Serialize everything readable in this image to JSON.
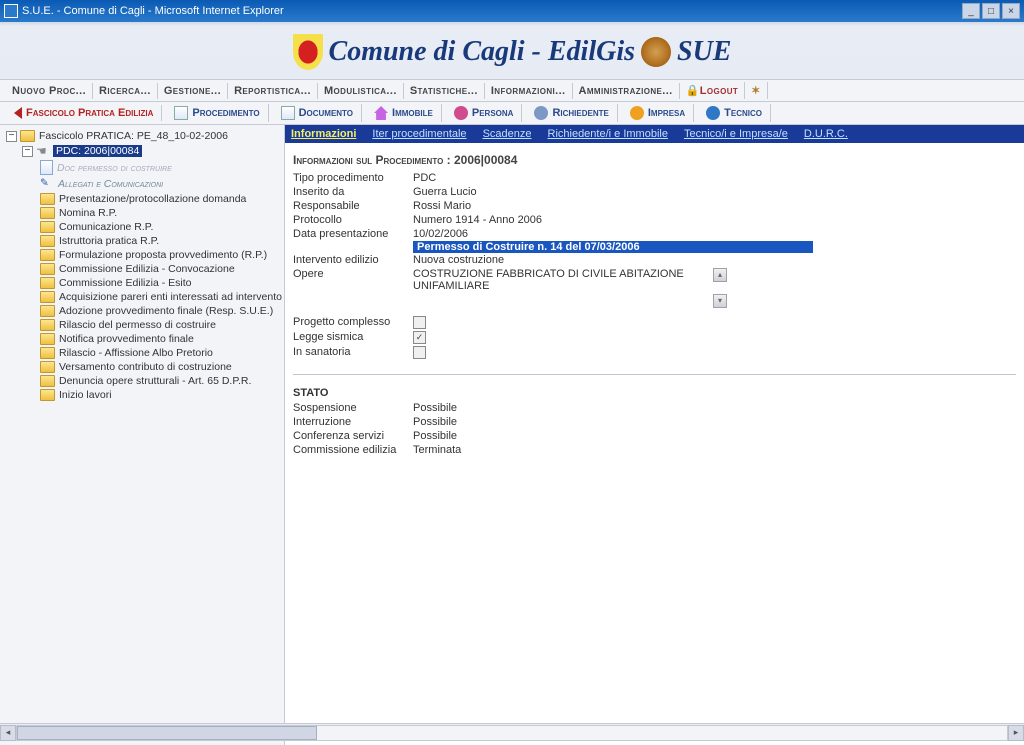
{
  "window": {
    "title": "S.U.E. - Comune di Cagli - Microsoft Internet Explorer"
  },
  "header": {
    "title_a": "Comune di Cagli - EdilGis",
    "title_b": "SUE"
  },
  "toolbar": {
    "items": [
      "Nuovo Proc...",
      "Ricerca...",
      "Gestione...",
      "Reportistica...",
      "Modulistica...",
      "Statistiche...",
      "Informazioni...",
      "Amministrazione..."
    ],
    "logout": "Logout"
  },
  "subtoolbar": {
    "fascicolo": "Fascicolo Pratica Edilizia",
    "procedimento": "Procedimento",
    "documento": "Documento",
    "immobile": "Immobile",
    "persona": "Persona",
    "richiedente": "Richiedente",
    "impresa": "Impresa",
    "tecnico": "Tecnico"
  },
  "tree": {
    "root": "Fascicolo PRATICA: PE_48_10-02-2006",
    "selected": "PDC: 2006|00084",
    "doc": "Doc permesso di costruire",
    "allegati": "Allegati e Comunicazioni",
    "items": [
      "Presentazione/protocollazione domanda",
      "Nomina R.P.",
      "Comunicazione R.P.",
      "Istruttoria pratica R.P.",
      "Formulazione proposta provvedimento (R.P.)",
      "Commissione Edilizia - Convocazione",
      "Commissione Edilizia - Esito",
      "Acquisizione pareri enti interessati ad intervento",
      "Adozione provvedimento finale (Resp. S.U.E.)",
      "Rilascio del permesso di costruire",
      "Notifica provvedimento finale",
      "Rilascio - Affissione Albo Pretorio",
      "Versamento contributo di costruzione",
      "Denuncia opere strutturali - Art. 65 D.P.R.",
      "Inizio lavori"
    ]
  },
  "tabs": {
    "items": [
      "Informazioni",
      "Iter procedimentale",
      "Scadenze",
      "Richiedente/i e Immobile",
      "Tecnico/i e Impresa/e",
      "D.U.R.C."
    ]
  },
  "info": {
    "title_prefix": "Informazioni sul Procedimento : ",
    "title_val": "2006|00084",
    "rows": {
      "tipo_k": "Tipo procedimento",
      "tipo_v": "PDC",
      "inserito_k": "Inserito da",
      "inserito_v": "Guerra Lucio",
      "resp_k": "Responsabile",
      "resp_v": "Rossi Mario",
      "proto_k": "Protocollo",
      "proto_v": "Numero 1914 - Anno 2006",
      "data_k": "Data presentazione",
      "data_v": "10/02/2006",
      "highlight": "Permesso di Costruire n. 14 del 07/03/2006",
      "interv_k": "Intervento edilizio",
      "interv_v": "Nuova costruzione",
      "opere_k": "Opere",
      "opere_v": "COSTRUZIONE FABBRICATO DI CIVILE ABITAZIONE UNIFAMILIARE",
      "prog_k": "Progetto complesso",
      "legge_k": "Legge sismica",
      "sanat_k": "In sanatoria"
    }
  },
  "stato": {
    "title": "STATO",
    "rows": {
      "sosp_k": "Sospensione",
      "sosp_v": "Possibile",
      "intr_k": "Interruzione",
      "intr_v": "Possibile",
      "conf_k": "Conferenza servizi",
      "conf_v": "Possibile",
      "comm_k": "Commissione edilizia",
      "comm_v": "Terminata"
    }
  }
}
